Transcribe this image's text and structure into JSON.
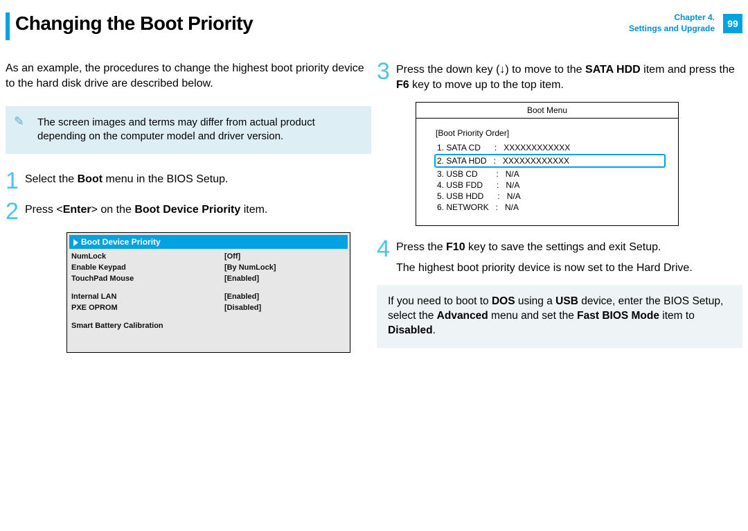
{
  "header": {
    "title": "Changing the Boot Priority",
    "chapter_line1": "Chapter 4.",
    "chapter_line2": "Settings and Upgrade",
    "page_number": "99"
  },
  "left": {
    "intro": "As an example, the procedures to change the highest boot priority device to the hard disk drive are described below.",
    "note": "The screen images and terms may differ from actual product depending on the computer model and driver version.",
    "step1_pre": "Select the ",
    "step1_bold": "Boot",
    "step1_post": " menu in the BIOS Setup.",
    "step2_pre": "Press <",
    "step2_bold1": "Enter",
    "step2_mid": "> on the ",
    "step2_bold2": "Boot Device Priority",
    "step2_post": " item.",
    "bios_highlight": "Boot Device Priority",
    "bios_rows": [
      {
        "k": "NumLock",
        "v": "[Off]"
      },
      {
        "k": "Enable Keypad",
        "v": "[By NumLock]"
      },
      {
        "k": "TouchPad Mouse",
        "v": "[Enabled]"
      }
    ],
    "bios_rows2": [
      {
        "k": "Internal LAN",
        "v": "[Enabled]"
      },
      {
        "k": "PXE OPROM",
        "v": "[Disabled]"
      }
    ],
    "bios_last": "Smart Battery Calibration"
  },
  "right": {
    "step3_a": "Press the down key (↓) to move to the ",
    "step3_bold": "SATA HDD",
    "step3_b": " item and press the ",
    "step3_bold2": "F6",
    "step3_c": " key to move up to the top item.",
    "bootmenu_title": "Boot Menu",
    "bootmenu_sub": "[Boot Priority Order]",
    "bootmenu_rows": [
      "1. SATA CD      :   XXXXXXXXXXXX",
      "2. SATA HDD   :   XXXXXXXXXXXX",
      "3. USB CD        :   N/A",
      "4. USB FDD      :   N/A",
      "5. USB HDD      :   N/A",
      "6. NETWORK   :   N/A"
    ],
    "bootmenu_selected_index": 1,
    "step4_a": "Press the ",
    "step4_bold": "F10",
    "step4_b": " key to save the settings and exit Setup.",
    "step4_line2": "The highest boot priority device is now set to the Hard Drive.",
    "tip_a": "If you need to boot to ",
    "tip_b1": "DOS",
    "tip_b": " using a ",
    "tip_b2": "USB",
    "tip_c": " device, enter the BIOS Setup, select the ",
    "tip_b3": "Advanced",
    "tip_d": " menu and set the ",
    "tip_b4": "Fast BIOS Mode",
    "tip_e": " item to ",
    "tip_b5": "Disabled",
    "tip_f": "."
  }
}
